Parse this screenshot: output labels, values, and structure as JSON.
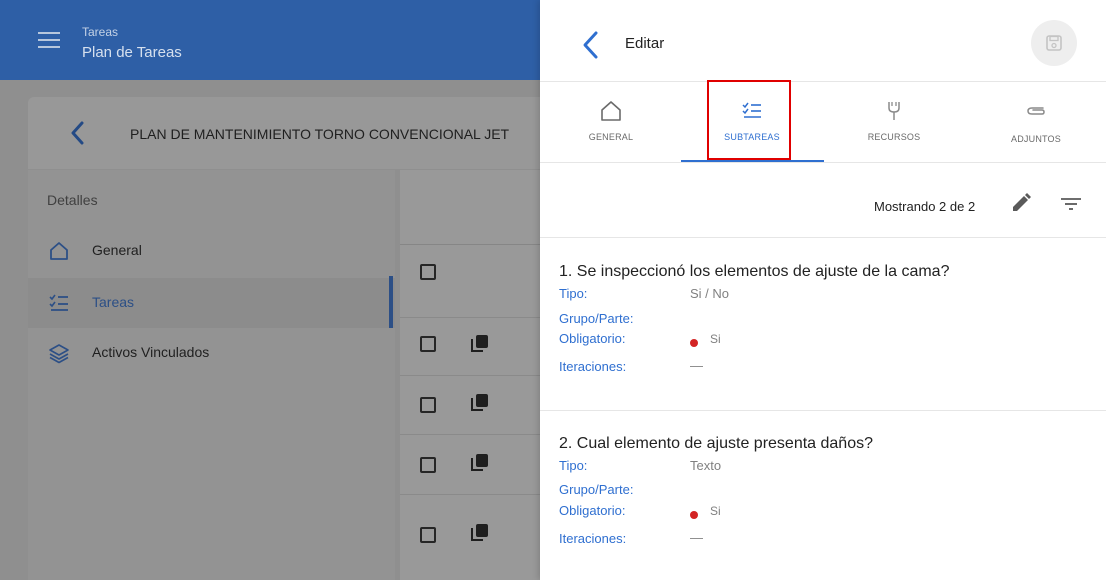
{
  "app": {
    "header": {
      "section": "Tareas",
      "title": "Plan de Tareas"
    },
    "plan_title": "PLAN DE MANTENIMIENTO TORNO CONVENCIONAL JET",
    "details_label": "Detalles",
    "nav": [
      {
        "label": "General",
        "icon": "home-icon",
        "active": false
      },
      {
        "label": "Tareas",
        "icon": "task-list-icon",
        "active": true
      },
      {
        "label": "Activos Vinculados",
        "icon": "layers-icon",
        "active": false
      }
    ]
  },
  "drawer": {
    "title": "Editar",
    "tabs": [
      {
        "label": "GENERAL",
        "icon": "home-icon"
      },
      {
        "label": "SUBTAREAS",
        "icon": "task-list-icon",
        "active": true
      },
      {
        "label": "RECURSOS",
        "icon": "tools-icon"
      },
      {
        "label": "ADJUNTOS",
        "icon": "paperclip-icon"
      }
    ],
    "showing": "Mostrando 2 de 2",
    "field_labels": {
      "tipo": "Tipo:",
      "grupo": "Grupo/Parte:",
      "obligatorio": "Obligatorio:",
      "iteraciones": "Iteraciones:"
    },
    "subtasks": [
      {
        "title": "1. Se inspeccionó los elementos de ajuste de la cama?",
        "tipo": "Si / No",
        "grupo": "",
        "obligatorio": "Si",
        "iteraciones": "—"
      },
      {
        "title": "2. Cual elemento de ajuste presenta daños?",
        "tipo": "Texto",
        "grupo": "",
        "obligatorio": "Si",
        "iteraciones": "—"
      }
    ]
  },
  "colors": {
    "header_blue": "#2e5fa6",
    "accent_blue": "#2f6fd0",
    "highlight_red": "#e00000",
    "required_dot": "#d32424"
  }
}
